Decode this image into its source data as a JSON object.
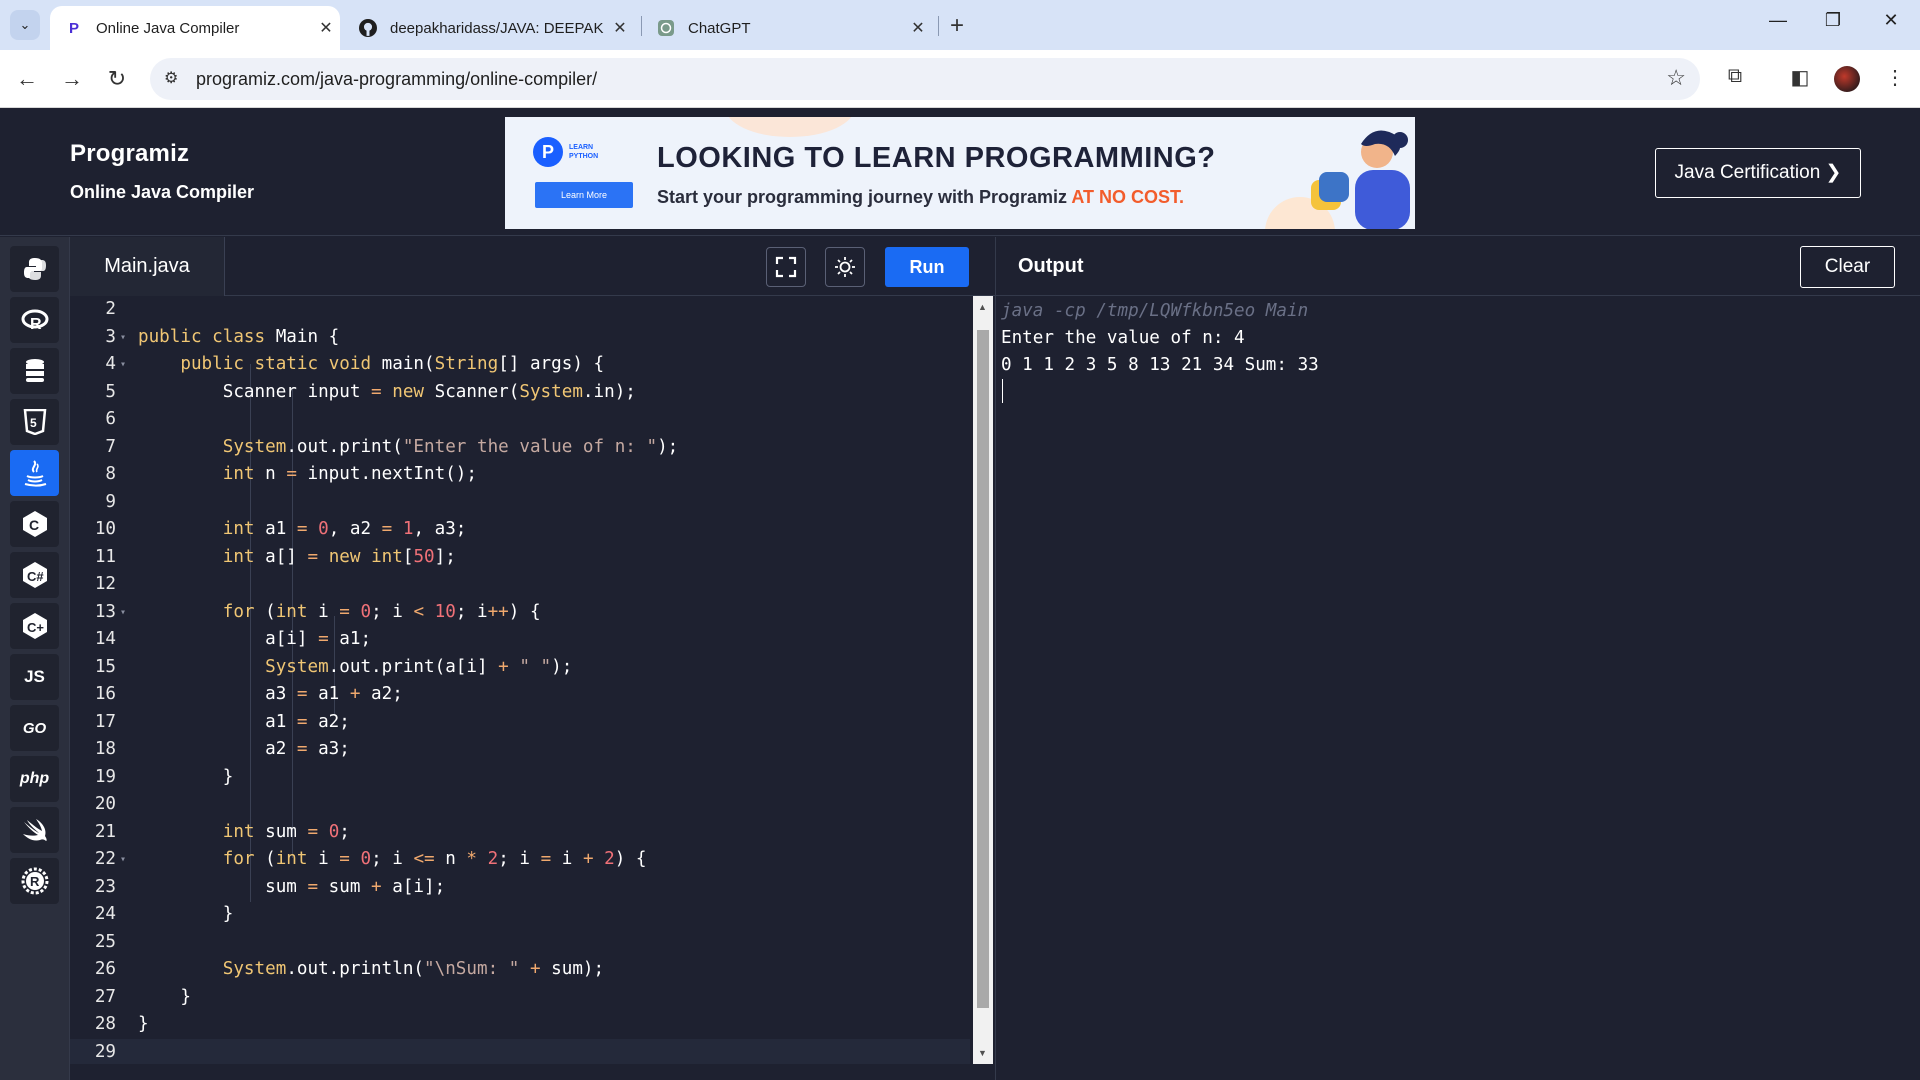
{
  "browser": {
    "tabs": [
      {
        "title": "Online Java Compiler",
        "icon": "programiz-favicon",
        "active": true
      },
      {
        "title": "deepakharidass/JAVA: DEEPAK",
        "icon": "github-icon",
        "active": false
      },
      {
        "title": "ChatGPT",
        "icon": "chatgpt-icon",
        "active": false
      }
    ],
    "url": "programiz.com/java-programming/online-compiler/"
  },
  "header": {
    "logo": "Programiz",
    "subtitle": "Online Java Compiler",
    "cert_button": "Java Certification ❯"
  },
  "banner": {
    "badge_text": "LEARN PYTHON",
    "learn_more": "Learn More",
    "headline": "LOOKING TO LEARN PROGRAMMING?",
    "tagline_prefix": "Start your programming journey with Programiz ",
    "tagline_highlight": "AT NO COST."
  },
  "languages": [
    {
      "name": "python-icon",
      "label": "",
      "active": false
    },
    {
      "name": "r-icon",
      "label": "R",
      "active": false
    },
    {
      "name": "sql-icon",
      "label": "",
      "active": false
    },
    {
      "name": "html5-icon",
      "label": "5",
      "active": false
    },
    {
      "name": "java-icon",
      "label": "",
      "active": true
    },
    {
      "name": "c-icon",
      "label": "C",
      "active": false
    },
    {
      "name": "csharp-icon",
      "label": "C#",
      "active": false
    },
    {
      "name": "cpp-icon",
      "label": "C+",
      "active": false
    },
    {
      "name": "js-icon",
      "label": "JS",
      "active": false
    },
    {
      "name": "go-icon",
      "label": "GO",
      "active": false
    },
    {
      "name": "php-icon",
      "label": "php",
      "active": false
    },
    {
      "name": "swift-icon",
      "label": "",
      "active": false
    },
    {
      "name": "rust-icon",
      "label": "R",
      "active": false
    }
  ],
  "editor": {
    "filename": "Main.java",
    "run_label": "Run",
    "line_numbers": [
      "2",
      "3",
      "4",
      "5",
      "6",
      "7",
      "8",
      "9",
      "10",
      "11",
      "12",
      "13",
      "14",
      "15",
      "16",
      "17",
      "18",
      "19",
      "20",
      "21",
      "22",
      "23",
      "24",
      "25",
      "26",
      "27",
      "28",
      "29"
    ],
    "folds": {
      "3": true,
      "4": true,
      "13": true,
      "22": true
    }
  },
  "output": {
    "title": "Output",
    "clear_label": "Clear",
    "lines": [
      "java -cp /tmp/LQWfkbn5eo Main",
      "Enter the value of n: 4",
      "0 1 1 2 3 5 8 13 21 34 Sum: 33"
    ]
  },
  "code": [
    [],
    [
      [
        "kw",
        "public"
      ],
      [
        "t",
        " "
      ],
      [
        "kw",
        "class"
      ],
      [
        "t",
        " Main {"
      ]
    ],
    [
      [
        "t",
        "    "
      ],
      [
        "kw",
        "public"
      ],
      [
        "t",
        " "
      ],
      [
        "kw",
        "static"
      ],
      [
        "t",
        " "
      ],
      [
        "kw",
        "void"
      ],
      [
        "t",
        " main("
      ],
      [
        "typ",
        "String"
      ],
      [
        "t",
        "[] args) {"
      ]
    ],
    [
      [
        "t",
        "        Scanner input "
      ],
      [
        "op",
        "="
      ],
      [
        "t",
        " "
      ],
      [
        "kw",
        "new"
      ],
      [
        "t",
        " Scanner("
      ],
      [
        "typ",
        "System"
      ],
      [
        "t",
        ".in);"
      ]
    ],
    [],
    [
      [
        "t",
        "        "
      ],
      [
        "typ",
        "System"
      ],
      [
        "t",
        ".out.print("
      ],
      [
        "str",
        "\"Enter the value of n: \""
      ],
      [
        "t",
        ");"
      ]
    ],
    [
      [
        "t",
        "        "
      ],
      [
        "kw",
        "int"
      ],
      [
        "t",
        " n "
      ],
      [
        "op",
        "="
      ],
      [
        "t",
        " input.nextInt();"
      ]
    ],
    [],
    [
      [
        "t",
        "        "
      ],
      [
        "kw",
        "int"
      ],
      [
        "t",
        " a1 "
      ],
      [
        "op",
        "="
      ],
      [
        "t",
        " "
      ],
      [
        "num",
        "0"
      ],
      [
        "t",
        ", a2 "
      ],
      [
        "op",
        "="
      ],
      [
        "t",
        " "
      ],
      [
        "num",
        "1"
      ],
      [
        "t",
        ", a3;"
      ]
    ],
    [
      [
        "t",
        "        "
      ],
      [
        "kw",
        "int"
      ],
      [
        "t",
        " a[] "
      ],
      [
        "op",
        "="
      ],
      [
        "t",
        " "
      ],
      [
        "kw",
        "new"
      ],
      [
        "t",
        " "
      ],
      [
        "kw",
        "int"
      ],
      [
        "t",
        "["
      ],
      [
        "num",
        "50"
      ],
      [
        "t",
        "];"
      ]
    ],
    [],
    [
      [
        "t",
        "        "
      ],
      [
        "kw",
        "for"
      ],
      [
        "t",
        " ("
      ],
      [
        "kw",
        "int"
      ],
      [
        "t",
        " i "
      ],
      [
        "op",
        "="
      ],
      [
        "t",
        " "
      ],
      [
        "num",
        "0"
      ],
      [
        "t",
        "; i "
      ],
      [
        "op",
        "<"
      ],
      [
        "t",
        " "
      ],
      [
        "num",
        "10"
      ],
      [
        "t",
        "; i"
      ],
      [
        "op",
        "++"
      ],
      [
        "t",
        ") {"
      ]
    ],
    [
      [
        "t",
        "            a[i] "
      ],
      [
        "op",
        "="
      ],
      [
        "t",
        " a1;"
      ]
    ],
    [
      [
        "t",
        "            "
      ],
      [
        "typ",
        "System"
      ],
      [
        "t",
        ".out.print(a[i] "
      ],
      [
        "op",
        "+"
      ],
      [
        "t",
        " "
      ],
      [
        "str",
        "\" \""
      ],
      [
        "t",
        ");"
      ]
    ],
    [
      [
        "t",
        "            a3 "
      ],
      [
        "op",
        "="
      ],
      [
        "t",
        " a1 "
      ],
      [
        "op",
        "+"
      ],
      [
        "t",
        " a2;"
      ]
    ],
    [
      [
        "t",
        "            a1 "
      ],
      [
        "op",
        "="
      ],
      [
        "t",
        " a2;"
      ]
    ],
    [
      [
        "t",
        "            a2 "
      ],
      [
        "op",
        "="
      ],
      [
        "t",
        " a3;"
      ]
    ],
    [
      [
        "t",
        "        }"
      ]
    ],
    [],
    [
      [
        "t",
        "        "
      ],
      [
        "kw",
        "int"
      ],
      [
        "t",
        " sum "
      ],
      [
        "op",
        "="
      ],
      [
        "t",
        " "
      ],
      [
        "num",
        "0"
      ],
      [
        "t",
        ";"
      ]
    ],
    [
      [
        "t",
        "        "
      ],
      [
        "kw",
        "for"
      ],
      [
        "t",
        " ("
      ],
      [
        "kw",
        "int"
      ],
      [
        "t",
        " i "
      ],
      [
        "op",
        "="
      ],
      [
        "t",
        " "
      ],
      [
        "num",
        "0"
      ],
      [
        "t",
        "; i "
      ],
      [
        "op",
        "<="
      ],
      [
        "t",
        " n "
      ],
      [
        "op",
        "*"
      ],
      [
        "t",
        " "
      ],
      [
        "num",
        "2"
      ],
      [
        "t",
        "; i "
      ],
      [
        "op",
        "="
      ],
      [
        "t",
        " i "
      ],
      [
        "op",
        "+"
      ],
      [
        "t",
        " "
      ],
      [
        "num",
        "2"
      ],
      [
        "t",
        ") {"
      ]
    ],
    [
      [
        "t",
        "            sum "
      ],
      [
        "op",
        "="
      ],
      [
        "t",
        " sum "
      ],
      [
        "op",
        "+"
      ],
      [
        "t",
        " a[i];"
      ]
    ],
    [
      [
        "t",
        "        }"
      ]
    ],
    [],
    [
      [
        "t",
        "        "
      ],
      [
        "typ",
        "System"
      ],
      [
        "t",
        ".out.println("
      ],
      [
        "str",
        "\"\\nSum: \""
      ],
      [
        "t",
        " "
      ],
      [
        "op",
        "+"
      ],
      [
        "t",
        " sum);"
      ]
    ],
    [
      [
        "t",
        "    }"
      ]
    ],
    [
      [
        "t",
        "}"
      ]
    ],
    []
  ]
}
